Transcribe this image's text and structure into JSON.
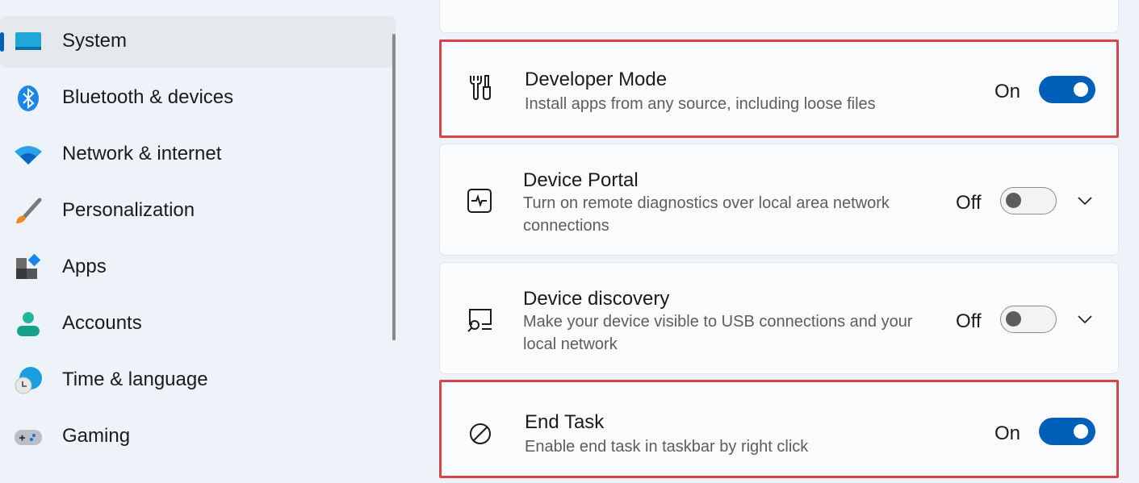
{
  "sidebar": {
    "items": [
      {
        "label": "System",
        "icon": "system-icon",
        "selected": true
      },
      {
        "label": "Bluetooth & devices",
        "icon": "bluetooth-icon"
      },
      {
        "label": "Network & internet",
        "icon": "wifi-icon"
      },
      {
        "label": "Personalization",
        "icon": "paintbrush-icon"
      },
      {
        "label": "Apps",
        "icon": "apps-icon"
      },
      {
        "label": "Accounts",
        "icon": "person-icon"
      },
      {
        "label": "Time & language",
        "icon": "globe-clock-icon"
      },
      {
        "label": "Gaming",
        "icon": "gamepad-icon"
      }
    ]
  },
  "settings": [
    {
      "title": "Developer Mode",
      "desc": "Install apps from any source, including loose files",
      "state": "On",
      "on": true,
      "icon": "tools-icon",
      "highlighted": true
    },
    {
      "title": "Device Portal",
      "desc": "Turn on remote diagnostics over local area network connections",
      "state": "Off",
      "on": false,
      "icon": "pulse-monitor-icon",
      "expandable": true
    },
    {
      "title": "Device discovery",
      "desc": "Make your device visible to USB connections and your local network",
      "state": "Off",
      "on": false,
      "icon": "device-search-icon",
      "expandable": true
    },
    {
      "title": "End Task",
      "desc": "Enable end task in taskbar by right click",
      "state": "On",
      "on": true,
      "icon": "prohibited-icon",
      "highlighted": true
    }
  ],
  "colors": {
    "accent": "#005fb8",
    "highlight": "#d9434a"
  }
}
